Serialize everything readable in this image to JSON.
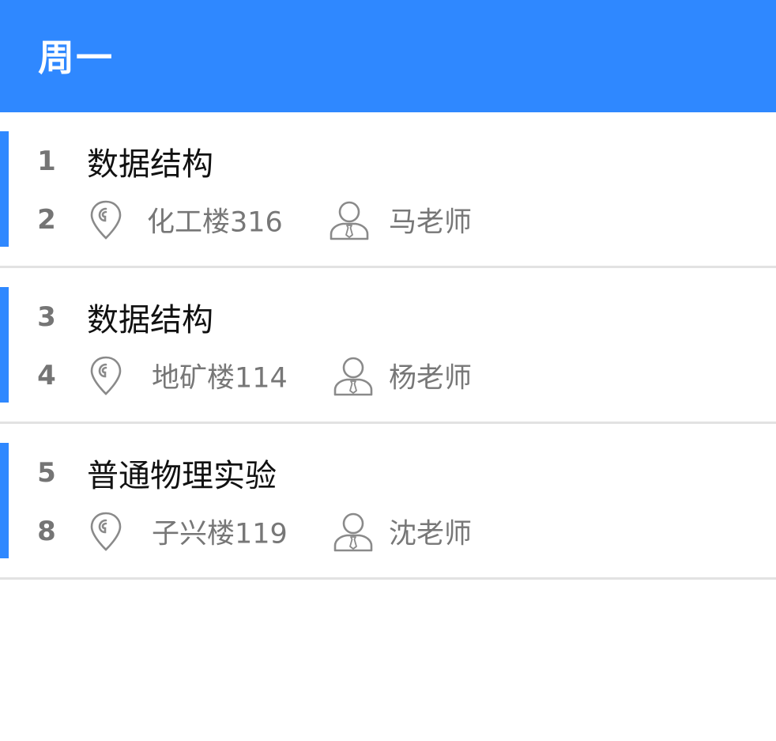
{
  "header": {
    "title": "周一",
    "background_color": "#2f88ff"
  },
  "courses": [
    {
      "start_period": "1",
      "end_period": "2",
      "name": "数据结构",
      "location": "化工楼316",
      "teacher": "马老师",
      "location_icon": "location-pin-icon",
      "teacher_icon": "teacher-icon"
    },
    {
      "start_period": "3",
      "end_period": "4",
      "name": "数据结构",
      "location": "地矿楼114",
      "teacher": "杨老师",
      "location_icon": "location-pin-icon",
      "teacher_icon": "teacher-icon"
    },
    {
      "start_period": "5",
      "end_period": "8",
      "name": "普通物理实验",
      "location": "子兴楼119",
      "teacher": "沈老师",
      "location_icon": "location-pin-icon",
      "teacher_icon": "teacher-icon"
    }
  ],
  "colors": {
    "accent": "#2f88ff",
    "secondary_text": "#777777",
    "divider": "#e2e2e2"
  }
}
